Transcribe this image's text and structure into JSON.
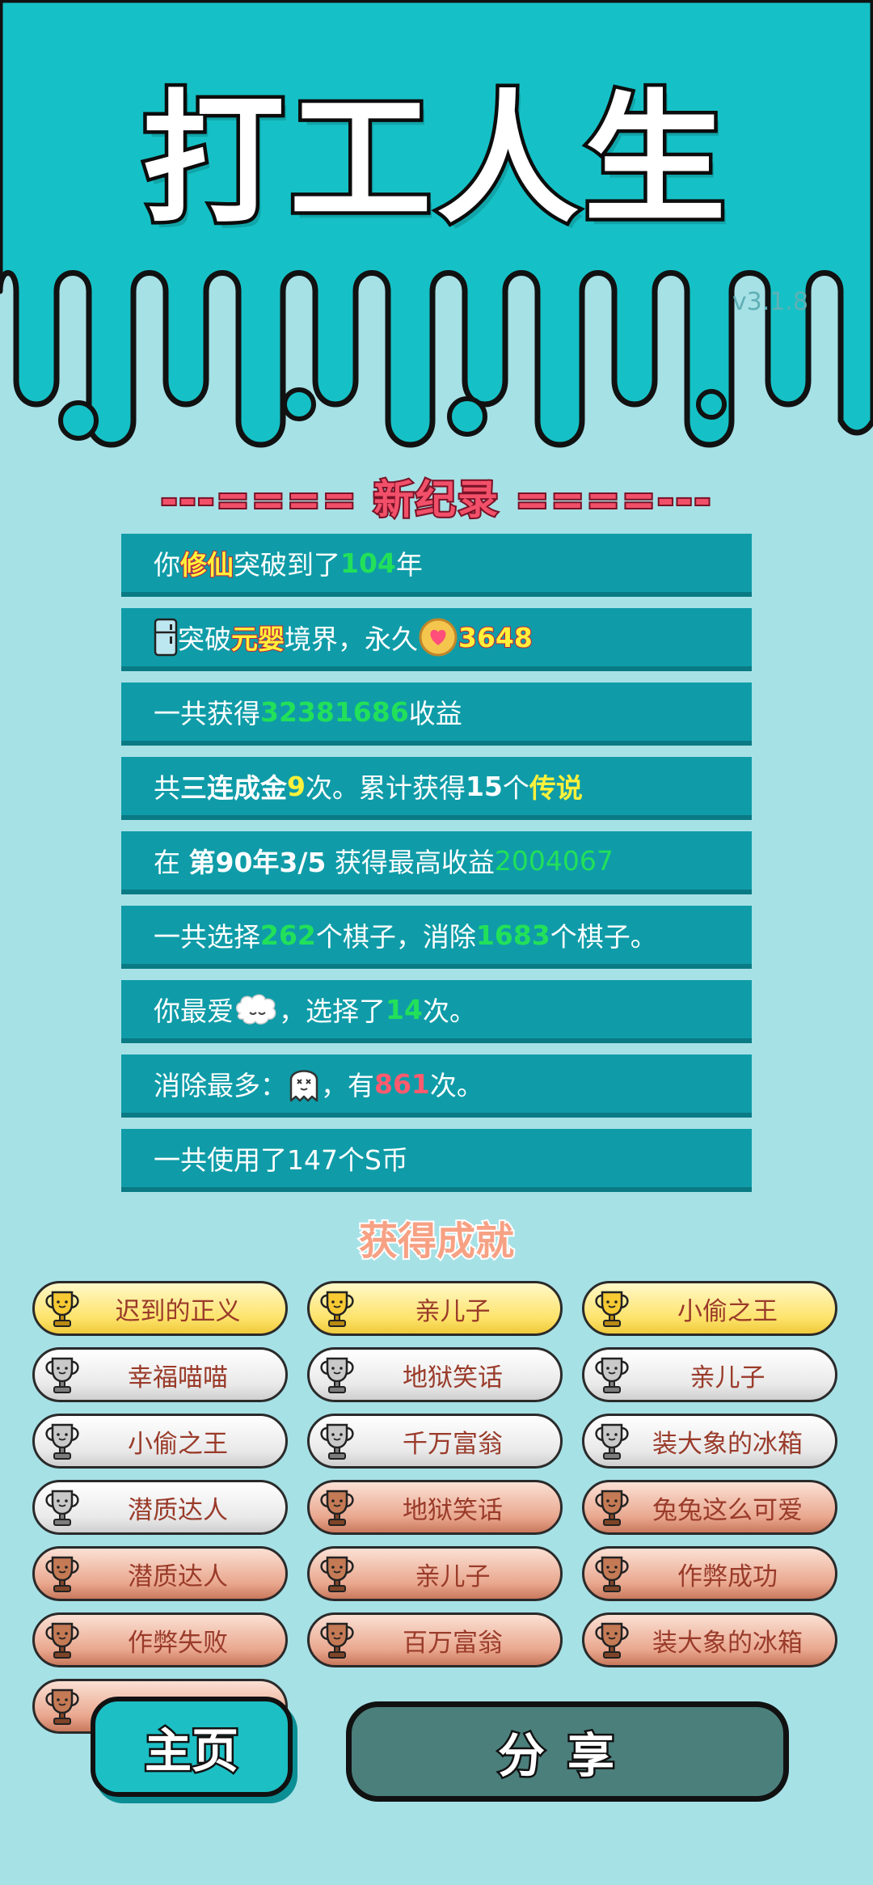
{
  "app": {
    "title": "打工人生",
    "version": "v3.1.8"
  },
  "record": {
    "title": "---==== 新纪录 ====---"
  },
  "stats": {
    "r1": {
      "p1": "你",
      "h1": "修仙",
      "p2": "突破到了",
      "n1": "104",
      "p3": "年"
    },
    "r2": {
      "p1": "突破",
      "h1": "元婴",
      "p2": "境界，永久",
      "n1": "3648"
    },
    "r3": {
      "p1": "一共获得",
      "n1": "32381686",
      "p2": "收益"
    },
    "r4": {
      "p1": "共",
      "b1": "三连成金",
      "n1": "9",
      "p2": "次。累计获得",
      "b2": "15",
      "p3": "个",
      "h1": "传说"
    },
    "r5": {
      "p1": "在 ",
      "b1": "第90年3/5",
      "p2": " 获得最高收益",
      "n1": "2004067"
    },
    "r6": {
      "p1": "一共选择",
      "n1": "262",
      "p2": "个棋子，消除",
      "n2": "1683",
      "p3": "个棋子。"
    },
    "r7": {
      "p1": "你最爱",
      "p2": "，选择了",
      "n1": "14",
      "p3": "次。"
    },
    "r8": {
      "p1": "消除最多：",
      "p2": "，有",
      "n1": "861",
      "p3": "次。"
    },
    "r9": {
      "p1": "一共使用了147个S币"
    }
  },
  "achievements": {
    "title": "获得成就",
    "items": [
      {
        "label": "迟到的正义",
        "tier": "gold"
      },
      {
        "label": "亲儿子",
        "tier": "gold"
      },
      {
        "label": "小偷之王",
        "tier": "gold"
      },
      {
        "label": "幸福喵喵",
        "tier": "silver"
      },
      {
        "label": "地狱笑话",
        "tier": "silver"
      },
      {
        "label": "亲儿子",
        "tier": "silver"
      },
      {
        "label": "小偷之王",
        "tier": "silver"
      },
      {
        "label": "千万富翁",
        "tier": "silver"
      },
      {
        "label": "装大象的冰箱",
        "tier": "silver"
      },
      {
        "label": "潜质达人",
        "tier": "silver"
      },
      {
        "label": "地狱笑话",
        "tier": "bronze"
      },
      {
        "label": "兔兔这么可爱",
        "tier": "bronze"
      },
      {
        "label": "潜质达人",
        "tier": "bronze"
      },
      {
        "label": "亲儿子",
        "tier": "bronze"
      },
      {
        "label": "作弊成功",
        "tier": "bronze"
      },
      {
        "label": "作弊失败",
        "tier": "bronze"
      },
      {
        "label": "百万富翁",
        "tier": "bronze"
      },
      {
        "label": "装大象的冰箱",
        "tier": "bronze"
      },
      {
        "label": "",
        "tier": "bronze"
      }
    ]
  },
  "buttons": {
    "home": "主页",
    "share": "分享"
  },
  "colors": {
    "header": "#15c1c6",
    "body": "#a6e1e6",
    "row": "#0f9ca8",
    "accent_green": "#22e05a",
    "accent_yellow": "#fff13a",
    "accent_red": "#ff5a6e"
  }
}
